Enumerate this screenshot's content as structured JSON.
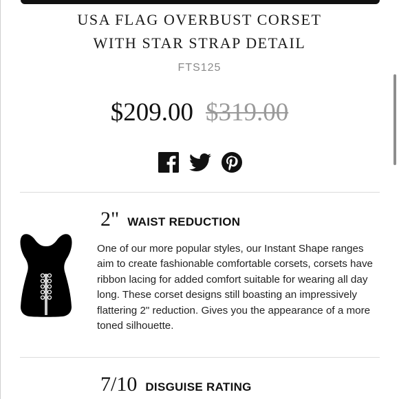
{
  "product": {
    "title_line1": "USA FLAG OVERBUST CORSET",
    "title_line2": "WITH STAR STRAP DETAIL",
    "sku": "FTS125",
    "price": "$209.00",
    "compare_at_price": "$319.00"
  },
  "share": {
    "icons": [
      "facebook-icon",
      "twitter-icon",
      "pinterest-icon"
    ]
  },
  "features": [
    {
      "number": "2\"",
      "label": "WAIST REDUCTION",
      "icon": "corset-icon",
      "description": "One of our more popular styles, our Instant Shape ranges aim to create fashionable comfortable corsets, corsets have ribbon lacing for added comfort suitable for wearing all day long. These corset designs still boasting an impressively flattering 2\" reduction. Gives you the appearance of a more toned silhouette."
    },
    {
      "number": "7/10",
      "label": "DISGUISE RATING"
    }
  ],
  "colors": {
    "text": "#111111",
    "muted": "#8a8a8a",
    "strikethrough": "#9a9a9a",
    "divider": "#dcdcdc"
  }
}
